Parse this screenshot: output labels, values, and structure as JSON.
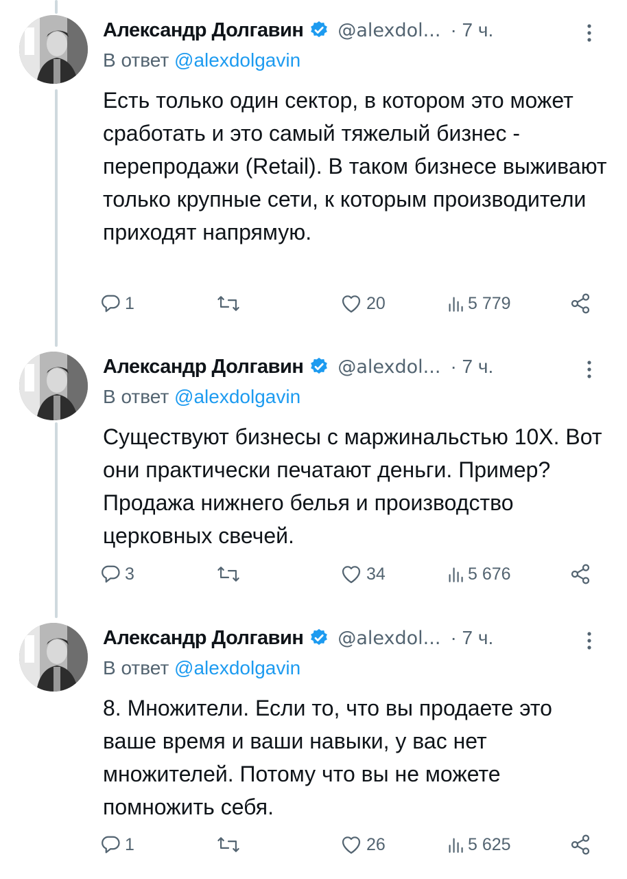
{
  "tweets": [
    {
      "author": "Александр Долгавин",
      "handle": "@alexdol...",
      "time": "· 7 ч.",
      "reply_prefix": "В ответ ",
      "reply_mention": "@alexdolgavin",
      "text": "Есть только один сектор, в котором это может сработать и это самый тяжелый бизнес - перепродажи (Retail). В таком бизнесе выживают только крупные сети, к которым производители приходят напрямую.",
      "replies": "1",
      "reposts": "",
      "likes": "20",
      "views": "5 779"
    },
    {
      "author": "Александр Долгавин",
      "handle": "@alexdol...",
      "time": "· 7 ч.",
      "reply_prefix": "В ответ ",
      "reply_mention": "@alexdolgavin",
      "text": "Существуют бизнесы с маржинальстью 10Х. Вот они практически печатают деньги. Пример? Продажа нижнего белья и производство церковных свечей.",
      "replies": "3",
      "reposts": "",
      "likes": "34",
      "views": "5 676"
    },
    {
      "author": "Александр Долгавин",
      "handle": "@alexdol...",
      "time": "· 7 ч.",
      "reply_prefix": "В ответ ",
      "reply_mention": "@alexdolgavin",
      "text": "8. Множители. Если то, что вы продаете это ваше время и ваши навыки, у вас нет множителей. Потому что вы не можете помножить себя.",
      "replies": "1",
      "reposts": "",
      "likes": "26",
      "views": "5 625"
    }
  ],
  "icons": {
    "verified": "verified-badge-icon",
    "more": "more-vertical-icon",
    "reply": "reply-icon",
    "repost": "repost-icon",
    "like": "heart-icon",
    "views": "views-bar-icon",
    "share": "share-icon"
  },
  "colors": {
    "accent": "#1d9bf0",
    "secondary_text": "#536471",
    "thread_line": "#cfd9de"
  }
}
